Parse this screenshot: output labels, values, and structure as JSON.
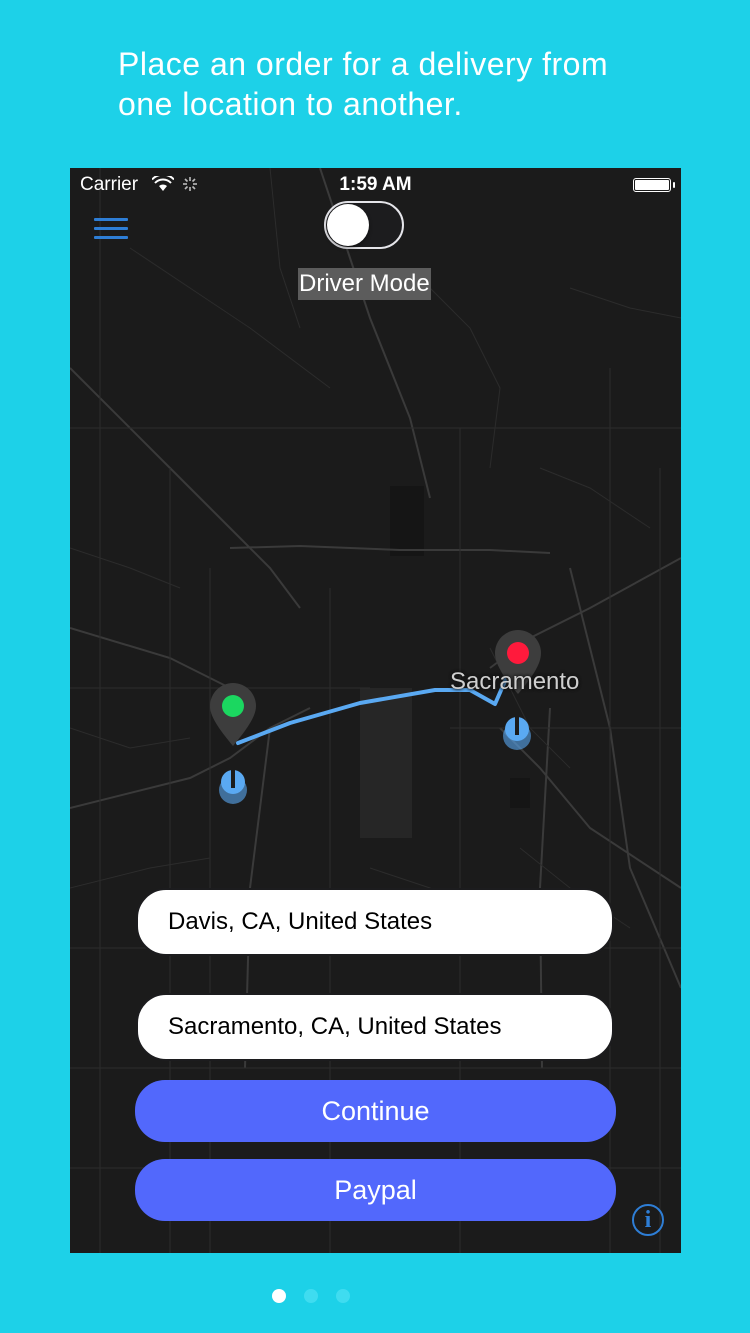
{
  "caption": "Place an order for a delivery from one location to another.",
  "status_bar": {
    "carrier": "Carrier",
    "time": "1:59 AM"
  },
  "header": {
    "driver_mode_label": "Driver Mode",
    "driver_mode_on": false
  },
  "map": {
    "city_label": "Sacramento",
    "pickup_pin_color": "#1bd760",
    "dropoff_pin_color": "#ff1a3c",
    "route_color": "#5aa9f2"
  },
  "form": {
    "pickup_value": "Davis, CA, United States",
    "dropoff_value": "Sacramento, CA, United States",
    "continue_label": "Continue",
    "paypal_label": "Paypal",
    "info_glyph": "i"
  },
  "pager": {
    "total": 3,
    "current": 1
  },
  "colors": {
    "background": "#1dd1e8",
    "button": "#5268fc",
    "accent_blue": "#2e7ed6"
  }
}
